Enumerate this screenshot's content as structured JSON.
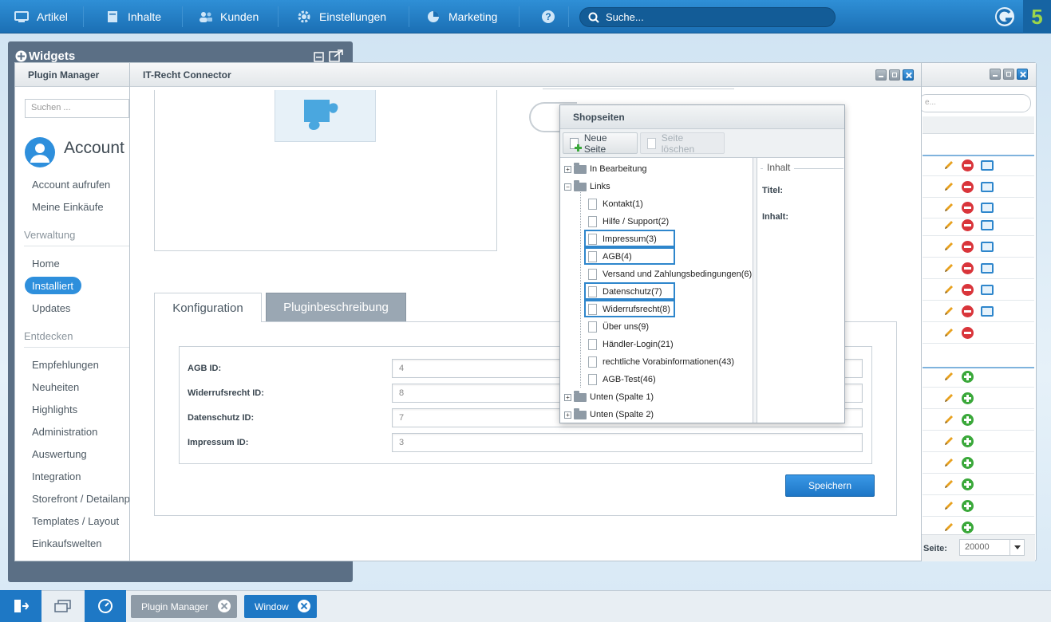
{
  "topnav": {
    "items": [
      "Artikel",
      "Inhalte",
      "Kunden",
      "Einstellungen",
      "Marketing"
    ],
    "search_placeholder": "Suche...",
    "logo_number": "5"
  },
  "widgets": {
    "title": "Widgets"
  },
  "plugin_manager": {
    "title": "Plugin Manager",
    "search_placeholder": "Suchen ...",
    "account_title": "Account",
    "account_items": [
      "Account aufrufen",
      "Meine Einkäufe"
    ],
    "section_verwaltung": "Verwaltung",
    "verwaltung_items": [
      "Home",
      "Installiert",
      "Updates"
    ],
    "section_entdecken": "Entdecken",
    "entdecken_items": [
      "Empfehlungen",
      "Neuheiten",
      "Highlights",
      "Administration",
      "Auswertung",
      "Integration",
      "Storefront / Detailanp",
      "Templates / Layout",
      "Einkaufswelten"
    ]
  },
  "main_window": {
    "title": "IT-Recht Connector",
    "tabs": [
      "Konfiguration",
      "Pluginbeschreibung"
    ],
    "fields": [
      {
        "label": "AGB ID:",
        "value": "4"
      },
      {
        "label": "Widerrufsrecht ID:",
        "value": "8"
      },
      {
        "label": "Datenschutz ID:",
        "value": "7"
      },
      {
        "label": "Impressum ID:",
        "value": "3"
      }
    ],
    "save_label": "Speichern"
  },
  "shopseiten": {
    "title": "Shopseiten",
    "new_page": "Neue Seite",
    "delete_page": "Seite löschen",
    "tree": [
      {
        "label": "In Bearbeitung",
        "type": "folder",
        "expanded": false
      },
      {
        "label": "Links",
        "type": "folder",
        "expanded": true
      },
      {
        "label": "Kontakt(1)",
        "type": "page"
      },
      {
        "label": "Hilfe / Support(2)",
        "type": "page"
      },
      {
        "label": "Impressum(3)",
        "type": "page"
      },
      {
        "label": "AGB(4)",
        "type": "page"
      },
      {
        "label": "Versand und Zahlungsbedingungen(6)",
        "type": "page"
      },
      {
        "label": "Datenschutz(7)",
        "type": "page"
      },
      {
        "label": "Widerrufsrecht(8)",
        "type": "page"
      },
      {
        "label": "Über uns(9)",
        "type": "page"
      },
      {
        "label": "Händler-Login(21)",
        "type": "page"
      },
      {
        "label": "rechtliche Vorabinformationen(43)",
        "type": "page"
      },
      {
        "label": "AGB-Test(46)",
        "type": "page"
      },
      {
        "label": "Unten (Spalte 1)",
        "type": "folder",
        "expanded": false
      },
      {
        "label": "Unten (Spalte 2)",
        "type": "folder",
        "expanded": false
      }
    ],
    "inhalt_legend": "Inhalt",
    "titel_label": "Titel:",
    "inhalt_label": "Inhalt:"
  },
  "right_window": {
    "search_placeholder": "e...",
    "seite_label": "Seite:",
    "seite_value": "20000"
  },
  "taskbar": {
    "buttons": [
      "Plugin Manager",
      "Window"
    ]
  }
}
